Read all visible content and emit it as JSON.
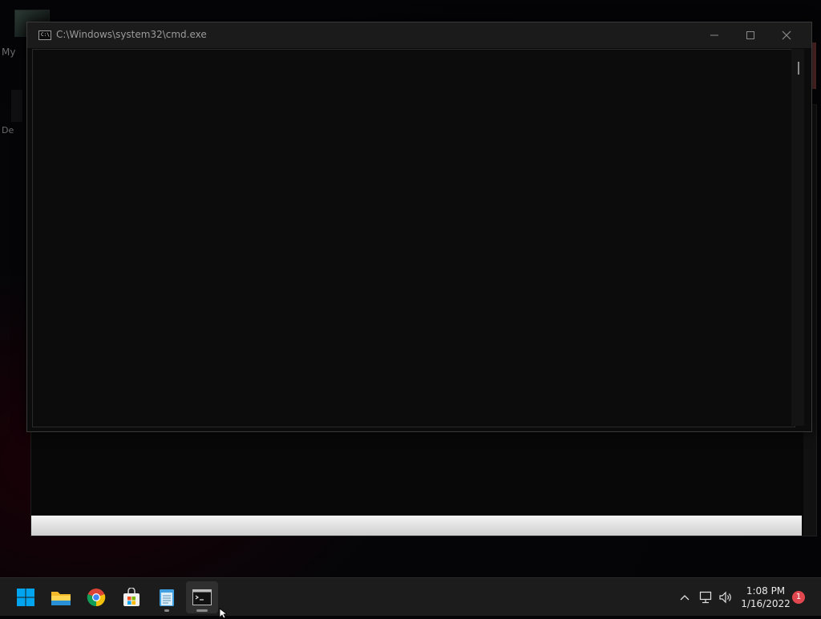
{
  "desktop": {
    "icon_labels": [
      "My",
      "De"
    ]
  },
  "cmd_window": {
    "title": "C:\\Windows\\system32\\cmd.exe",
    "icon_text": "C:\\",
    "console_text": ""
  },
  "taskbar": {
    "apps": [
      {
        "name": "start-button",
        "icon": "windows-logo-icon",
        "active": false
      },
      {
        "name": "file-explorer",
        "icon": "folder-icon",
        "active": false
      },
      {
        "name": "chrome",
        "icon": "chrome-icon",
        "active": false
      },
      {
        "name": "microsoft-store",
        "icon": "store-icon",
        "active": false
      },
      {
        "name": "notepad",
        "icon": "notepad-icon",
        "active": false,
        "running": true
      },
      {
        "name": "command-prompt",
        "icon": "cmd-icon",
        "active": true,
        "running": true
      }
    ],
    "clock": {
      "time": "1:08 PM",
      "date": "1/16/2022"
    },
    "notification_count": "1"
  },
  "colors": {
    "taskbar_bg": "#1c1c1c",
    "console_bg": "#0c0c0c",
    "windows_blue": "#00a4ef",
    "notification_red": "#e0474e"
  }
}
